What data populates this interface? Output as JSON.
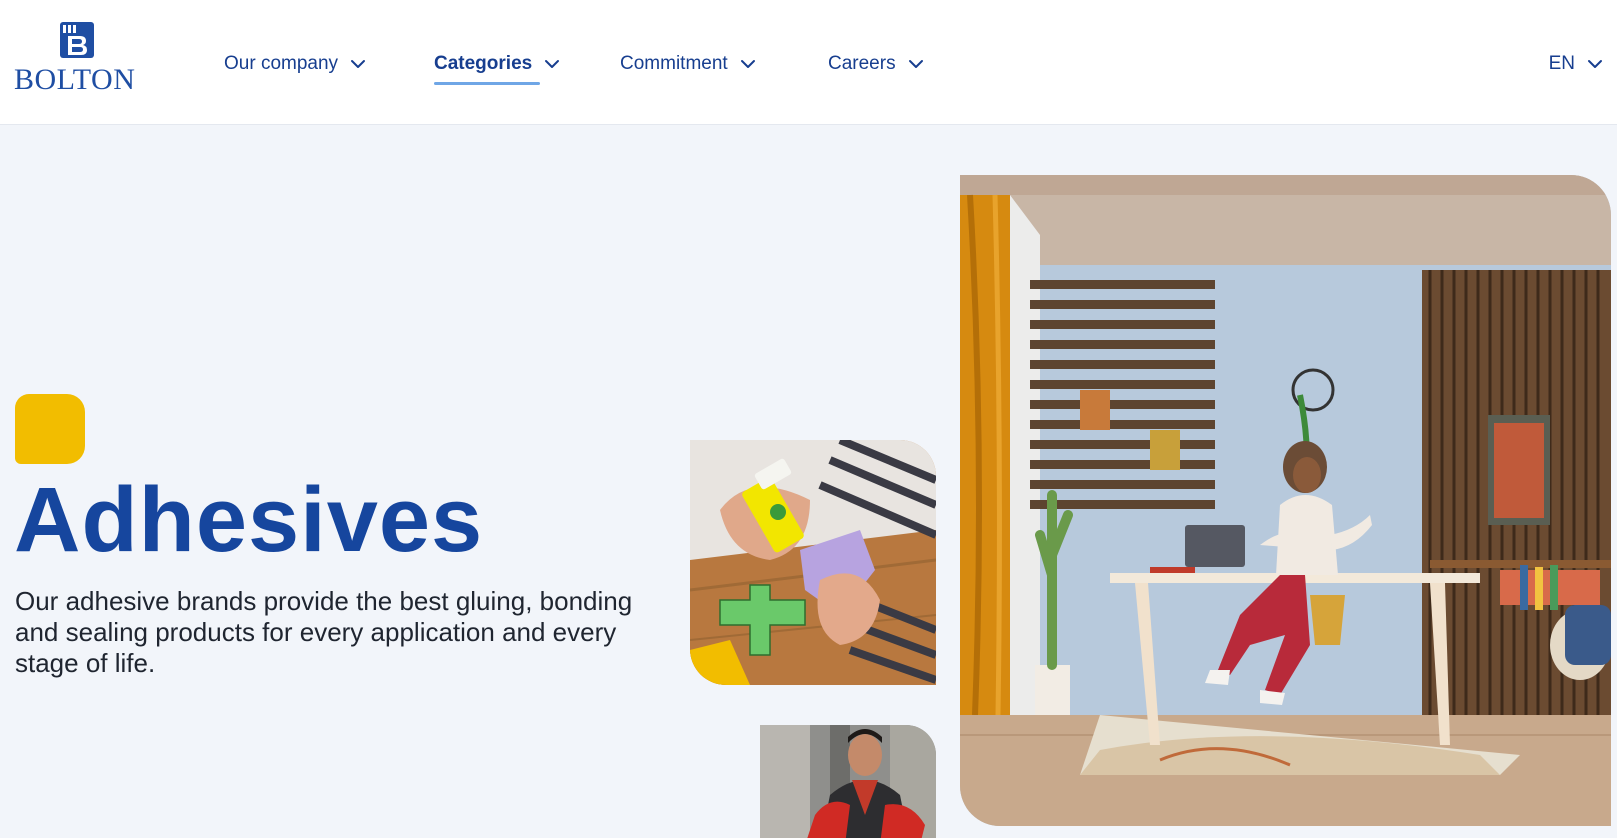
{
  "brand": {
    "name": "BOLTON",
    "logo_icon": "bolton-b-crest-icon",
    "color": "#1f4ea3"
  },
  "nav": {
    "items": [
      {
        "label": "Our company",
        "active": false
      },
      {
        "label": "Categories",
        "active": true
      },
      {
        "label": "Commitment",
        "active": false
      },
      {
        "label": "Careers",
        "active": false
      }
    ],
    "chevron_icon": "chevron-down-icon",
    "language": "EN"
  },
  "hero": {
    "title": "Adhesives",
    "description": "Our adhesive brands provide the best gluing, bonding and sealing products for every application and every stage of life.",
    "accent_color": "#f2bd00",
    "title_color": "#16469e"
  },
  "images": {
    "glue_stick": "photo-hands-glue-stick",
    "worker": "photo-man-working",
    "office": "photo-woman-home-office"
  }
}
